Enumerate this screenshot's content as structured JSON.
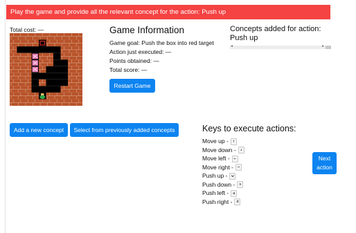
{
  "banner": {
    "text": "Play the game and provide all the relevant concept for the action: Push up"
  },
  "cost": {
    "label": "Total cost: —"
  },
  "game_info": {
    "title": "Game Information",
    "goal": "Game goal: Push the box into red target",
    "action": "Action just executed: —",
    "points": "Points obtained: —",
    "score": "Total score: —",
    "restart_label": "Restart Game"
  },
  "concepts": {
    "title": "Concepts added for action: Push up",
    "add_label": "Add a new concept",
    "select_label": "Select from previously added concepts"
  },
  "keys": {
    "title": "Keys to execute actions:",
    "items": [
      {
        "label": "Move up -",
        "key": "↑"
      },
      {
        "label": "Move down -",
        "key": "↓"
      },
      {
        "label": "Move left -",
        "key": "←"
      },
      {
        "label": "Move right -",
        "key": "→"
      },
      {
        "label": "Push up -",
        "key": "w"
      },
      {
        "label": "Push down -",
        "key": "s"
      },
      {
        "label": "Push left -",
        "key": "a"
      },
      {
        "label": "Push right -",
        "key": "d"
      }
    ]
  },
  "next": {
    "line1": "Next",
    "line2": "action"
  },
  "board": {
    "grid": [
      "WWWWWWWWWW",
      "WWWWTWWWWW",
      "WF.FFF.WWW",
      "WWW.WW.WWW",
      "WWW.WWFFWW",
      "WWW.WF.FWW",
      "WWW.FF.FWW",
      "WWW.WF..WW",
      "WWW..FFWWW",
      "WWWWPWWWWW",
      "WWWWWWWWWW"
    ],
    "boxes_on_column_rows": [
      3,
      4,
      5
    ],
    "colors": {
      "wall": "#b8532a",
      "mortar": "#d9a58a",
      "floor": "#000000",
      "box": "#e87bb6",
      "target": "#d42a2a",
      "player": "#2fa84a"
    }
  }
}
